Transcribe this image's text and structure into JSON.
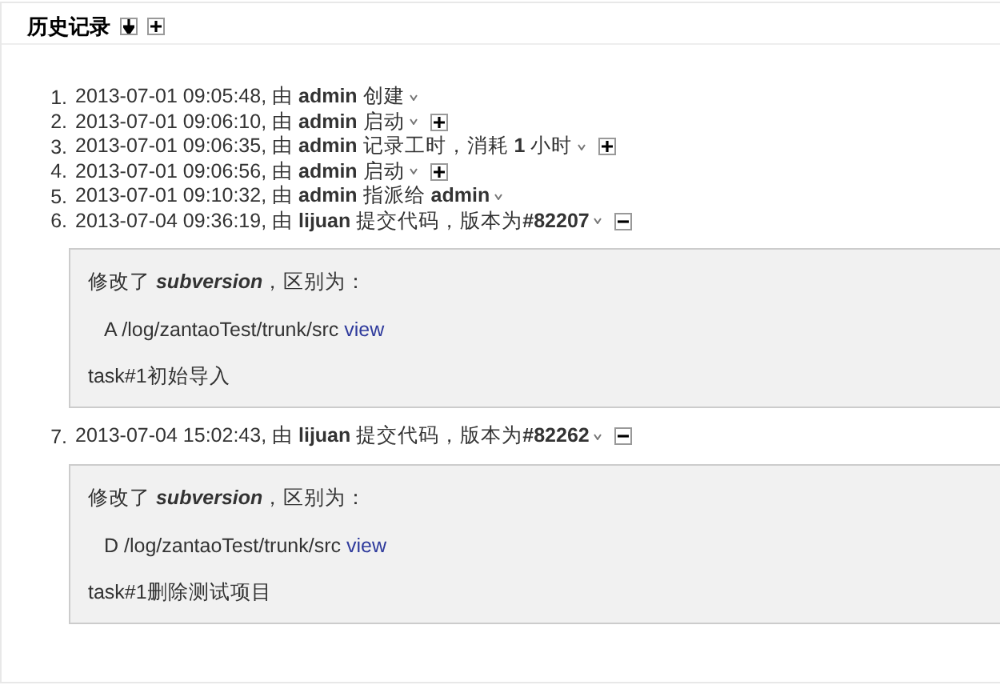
{
  "history": {
    "title": "历史记录",
    "entries": [
      {
        "number": "1.",
        "text": "2013-07-01 09:05:48, 由 **admin** 创建",
        "kind": "plain"
      },
      {
        "number": "2.",
        "text": "2013-07-01 09:06:10, 由 **admin** 启动",
        "kind": "expandable",
        "expanded": false
      },
      {
        "number": "3.",
        "text": "2013-07-01 09:06:35, 由 **admin** 记录工时，消耗 **1** 小时",
        "kind": "expandable",
        "expanded": false
      },
      {
        "number": "4.",
        "text": "2013-07-01 09:06:56, 由 **admin** 启动",
        "kind": "expandable",
        "expanded": false
      },
      {
        "number": "5.",
        "text": "2013-07-01 09:10:32, 由 **admin** 指派给 **admin**",
        "kind": "plain"
      },
      {
        "number": "6.",
        "text": "2013-07-04 09:36:19, 由 **lijuan** 提交代码，版本为**#82207**",
        "kind": "expandable",
        "expanded": true,
        "details": {
          "intro": "修改了 **subversion**，区别为：",
          "files": [
            {
              "action": "A",
              "path": "/log/zantaoTest/trunk/src",
              "link": "view"
            }
          ],
          "message": "task#1初始导入"
        }
      },
      {
        "number": "7.",
        "text": "2013-07-04 15:02:43, 由 **lijuan** 提交代码，版本为**#82262**",
        "kind": "expandable",
        "expanded": true,
        "details": {
          "intro": "修改了 **subversion**，区别为：",
          "files": [
            {
              "action": "D",
              "path": "/log/zantaoTest/trunk/src",
              "link": "view"
            }
          ],
          "message": "task#1删除测试项目"
        }
      }
    ]
  }
}
